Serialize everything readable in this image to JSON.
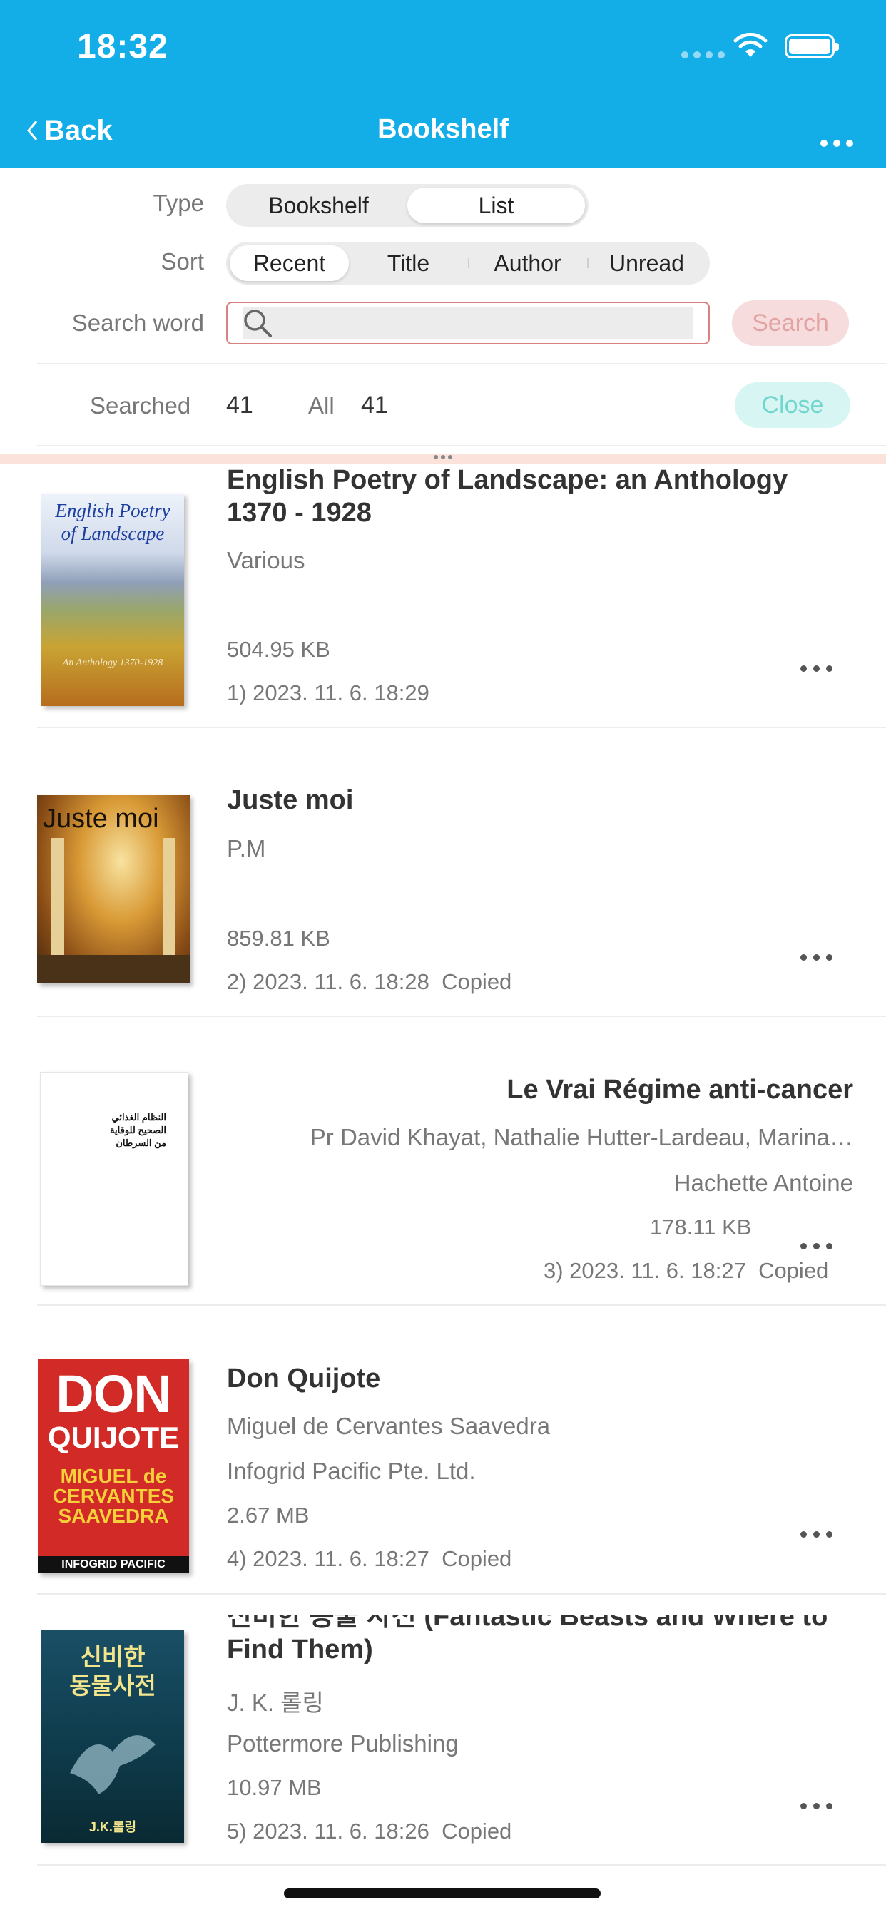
{
  "status_bar": {
    "time": "18:32"
  },
  "nav": {
    "back_label": "Back",
    "title": "Bookshelf"
  },
  "filters": {
    "type_label": "Type",
    "type_options": [
      "Bookshelf",
      "List"
    ],
    "type_selected": "List",
    "sort_label": "Sort",
    "sort_options": [
      "Recent",
      "Title",
      "Author",
      "Unread"
    ],
    "sort_selected": "Recent",
    "search_label": "Search word",
    "search_value": "",
    "search_button": "Search"
  },
  "counts": {
    "searched_label": "Searched",
    "searched_value": "41",
    "all_label": "All",
    "all_value": "41",
    "close_button": "Close"
  },
  "books": [
    {
      "title": "English Poetry of Landscape: an Anthology 1370 - 1928",
      "author": "Various",
      "publisher": "",
      "size": "504.95 KB",
      "date": "1) 2023. 11. 6.  18:29",
      "status": "",
      "cover_text": [
        "English Poetry",
        "of Landscape",
        "An Anthology 1370-1928"
      ]
    },
    {
      "title": "Juste moi",
      "author": "P.M",
      "publisher": "",
      "size": "859.81 KB",
      "date": "2) 2023. 11. 6.  18:28",
      "status": "Copied",
      "cover_text": [
        "Juste moi"
      ]
    },
    {
      "title": "Le Vrai Régime anti-cancer",
      "author": "Pr David Khayat, Nathalie Hutter-Lardeau, Marina…",
      "publisher": "Hachette Antoine",
      "size": "178.11 KB",
      "date": "3) 2023. 11. 6.  18:27",
      "status": "Copied",
      "cover_text": [
        "النظام الغذائي",
        "الصحيح للوقاية",
        "من السرطان"
      ]
    },
    {
      "title": "Don Quijote",
      "author": "Miguel de Cervantes Saavedra",
      "publisher": "Infogrid Pacific Pte. Ltd.",
      "size": "2.67 MB",
      "date": "4) 2023. 11. 6.  18:27",
      "status": "Copied",
      "cover_text": [
        "DON",
        "QUIJOTE",
        "MIGUEL de",
        "CERVANTES",
        "SAAVEDRA",
        "INFOGRID PACIFIC"
      ]
    },
    {
      "title": "신비한 동물 사전 (Fantastic Beasts and Where to Find Them)",
      "author": "J. K. 롤링",
      "publisher": "Pottermore Publishing",
      "size": "10.97 MB",
      "date": "5) 2023. 11. 6.  18:26",
      "status": "Copied",
      "cover_text": [
        "신비한",
        "동물사전",
        "J.K.롤링"
      ]
    }
  ],
  "colors": {
    "header": "#13ade8",
    "search_border": "#d98080",
    "close_bg": "#d6f5f3"
  }
}
